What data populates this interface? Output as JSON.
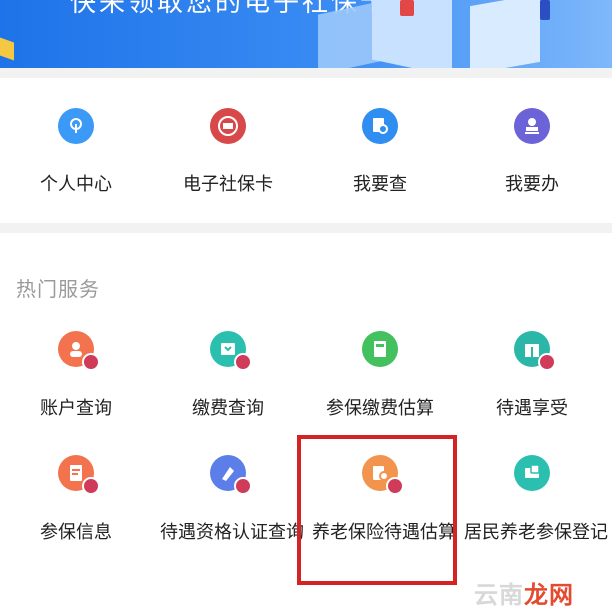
{
  "banner": {
    "text": "快来领取您的电子社保卡"
  },
  "quick_actions": [
    {
      "label": "个人中心",
      "icon": "touch-icon",
      "color": "#3b9af5"
    },
    {
      "label": "电子社保卡",
      "icon": "social-card-icon",
      "color": "#d94848"
    },
    {
      "label": "我要查",
      "icon": "search-doc-icon",
      "color": "#2f8ef0"
    },
    {
      "label": "我要办",
      "icon": "stamp-icon",
      "color": "#6c63d9"
    }
  ],
  "hot_services": {
    "title": "热门服务",
    "items": [
      {
        "label": "账户查询",
        "icon": "account-icon",
        "color": "#f2734e"
      },
      {
        "label": "缴费查询",
        "icon": "payment-icon",
        "color": "#2bbfb0"
      },
      {
        "label": "参保缴费估算",
        "icon": "calculator-icon",
        "color": "#43c15f"
      },
      {
        "label": "待遇享受",
        "icon": "gift-icon",
        "color": "#2bb7a8"
      },
      {
        "label": "参保信息",
        "icon": "info-doc-icon",
        "color": "#f2734e"
      },
      {
        "label": "待遇资格认证查询",
        "icon": "certify-icon",
        "color": "#5c7ee8"
      },
      {
        "label": "养老保险待遇估算",
        "icon": "pension-calc-icon",
        "color": "#f2944e"
      },
      {
        "label": "居民养老参保登记",
        "icon": "register-icon",
        "color": "#2bbfb0"
      }
    ]
  },
  "watermark": {
    "part1": "云南",
    "part2": "龙网"
  }
}
